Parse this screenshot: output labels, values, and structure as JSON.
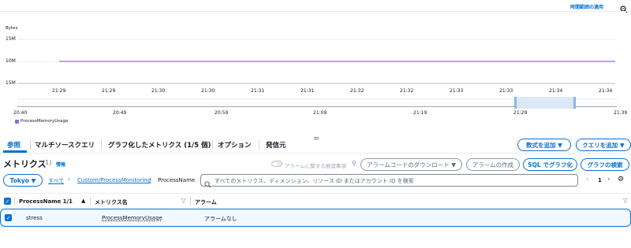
{
  "top": {
    "apply_time_range": "時間範囲の適用"
  },
  "chart": {
    "unit_label": "Bytes",
    "y_ticks": [
      "15M",
      "10M",
      "15M"
    ],
    "x_ticks": [
      "21:29",
      "21:29",
      "21:30",
      "21:30",
      "21:31",
      "21:31",
      "21:32",
      "21:32",
      "21:33",
      "21:33",
      "21:34",
      "21:34"
    ],
    "nav_ticks": [
      "20:40",
      "20:49",
      "20:59",
      "21:09",
      "21:19",
      "21:29",
      "21:39"
    ],
    "legend": "ProcessMemoryUsage",
    "series_color": "#9469d6"
  },
  "chart_data": {
    "type": "line",
    "ylabel": "Bytes",
    "y_tick_labels": [
      "15M",
      "10M",
      "15M"
    ],
    "x": [
      "21:29",
      "21:29",
      "21:30",
      "21:30",
      "21:31",
      "21:31",
      "21:32",
      "21:32",
      "21:33",
      "21:33",
      "21:34",
      "21:34"
    ],
    "series": [
      {
        "name": "ProcessMemoryUsage",
        "values": [
          10,
          10,
          10,
          10,
          10,
          10,
          10,
          10,
          10,
          10,
          10,
          10
        ]
      }
    ]
  },
  "tabs": [
    "参照",
    "マルチソースクエリ",
    "グラフ化したメトリクス (1/5 個)",
    "オプション",
    "発信元"
  ],
  "tab_buttons": {
    "add_math": "数式を追加 ▼",
    "add_query": "クエリを追加 ▼"
  },
  "metrics": {
    "title": "メトリクス",
    "count": "(1)",
    "info": "情報",
    "alarm_toggle": "アラームに関する推奨事項",
    "download_alarm_code": "アラームコードのダウンロード ▼",
    "create_alarm": "アラームの作成",
    "graph_with_sql": "SQL でグラフ化",
    "browse_graphs": "グラフの検索"
  },
  "filter": {
    "region": "Tokyo ▼",
    "breadcrumb": [
      "すべて",
      "Custom/ProcessMonitoring",
      "ProcessName"
    ],
    "search_placeholder": "すべてのメトリクス、ディメンション、リソース ID またはアカウント ID を検索",
    "page": "1"
  },
  "table": {
    "columns": [
      "ProcessName 1/1",
      "メトリクス名",
      "アラーム"
    ],
    "rows": [
      {
        "process": "stress",
        "metric": "ProcessMemoryUsage",
        "alarm": "アラームなし"
      }
    ]
  }
}
